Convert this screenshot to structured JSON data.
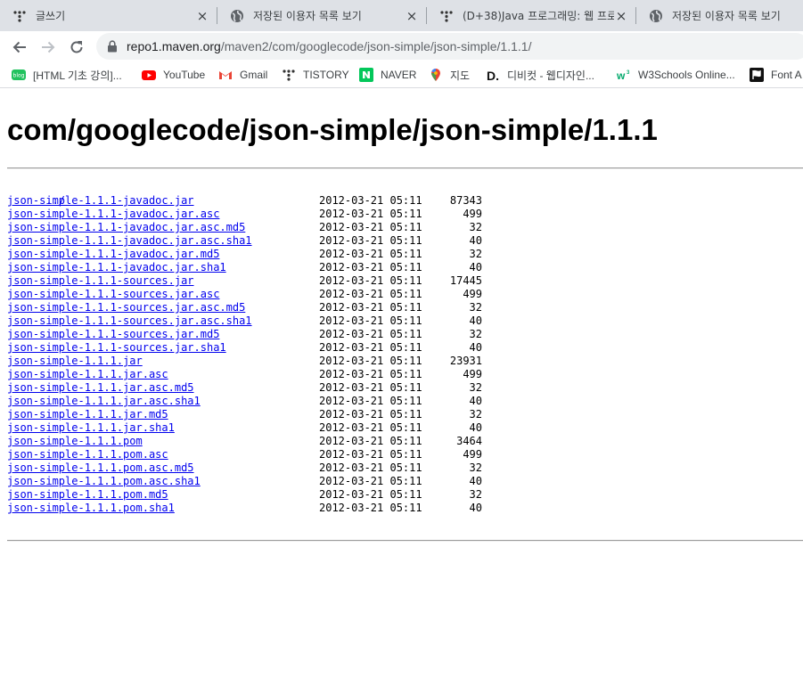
{
  "tabs": [
    {
      "title": "글쓰기",
      "icon": "tistory-icon",
      "close": "×"
    },
    {
      "title": "저장된 이용자 목록 보기",
      "icon": "globe-icon",
      "close": "×"
    },
    {
      "title": "(D+38)Java 프로그래밍: 웹 프로",
      "icon": "tistory-icon",
      "close": "×"
    },
    {
      "title": "저장된 이용자 목록 보기",
      "icon": "globe-icon",
      "close": ""
    }
  ],
  "address": {
    "host": "repo1.maven.org",
    "path": "/maven2/com/googlecode/json-simple/json-simple/1.1.1/"
  },
  "bookmarks": [
    {
      "label": "[HTML 기초 강의]...",
      "icon": "naver-blog-icon"
    },
    {
      "label": "YouTube",
      "icon": "youtube-icon"
    },
    {
      "label": "Gmail",
      "icon": "gmail-icon"
    },
    {
      "label": "TISTORY",
      "icon": "tistory-icon"
    },
    {
      "label": "NAVER",
      "icon": "naver-icon"
    },
    {
      "label": "지도",
      "icon": "google-maps-icon"
    },
    {
      "label": "디비컷 - 웹디자인...",
      "icon": "dbcut-icon"
    },
    {
      "label": "W3Schools Online...",
      "icon": "w3schools-icon"
    },
    {
      "label": "Font A",
      "icon": "font-awesome-icon"
    }
  ],
  "page": {
    "heading": "com/googlecode/json-simple/json-simple/1.1.1",
    "parent_link": "../",
    "files": [
      {
        "name": "json-simple-1.1.1-javadoc.jar",
        "date": "2012-03-21 05:11",
        "size": "87343"
      },
      {
        "name": "json-simple-1.1.1-javadoc.jar.asc",
        "date": "2012-03-21 05:11",
        "size": "499"
      },
      {
        "name": "json-simple-1.1.1-javadoc.jar.asc.md5",
        "date": "2012-03-21 05:11",
        "size": "32"
      },
      {
        "name": "json-simple-1.1.1-javadoc.jar.asc.sha1",
        "date": "2012-03-21 05:11",
        "size": "40"
      },
      {
        "name": "json-simple-1.1.1-javadoc.jar.md5",
        "date": "2012-03-21 05:11",
        "size": "32"
      },
      {
        "name": "json-simple-1.1.1-javadoc.jar.sha1",
        "date": "2012-03-21 05:11",
        "size": "40"
      },
      {
        "name": "json-simple-1.1.1-sources.jar",
        "date": "2012-03-21 05:11",
        "size": "17445"
      },
      {
        "name": "json-simple-1.1.1-sources.jar.asc",
        "date": "2012-03-21 05:11",
        "size": "499"
      },
      {
        "name": "json-simple-1.1.1-sources.jar.asc.md5",
        "date": "2012-03-21 05:11",
        "size": "32"
      },
      {
        "name": "json-simple-1.1.1-sources.jar.asc.sha1",
        "date": "2012-03-21 05:11",
        "size": "40"
      },
      {
        "name": "json-simple-1.1.1-sources.jar.md5",
        "date": "2012-03-21 05:11",
        "size": "32"
      },
      {
        "name": "json-simple-1.1.1-sources.jar.sha1",
        "date": "2012-03-21 05:11",
        "size": "40"
      },
      {
        "name": "json-simple-1.1.1.jar",
        "date": "2012-03-21 05:11",
        "size": "23931"
      },
      {
        "name": "json-simple-1.1.1.jar.asc",
        "date": "2012-03-21 05:11",
        "size": "499"
      },
      {
        "name": "json-simple-1.1.1.jar.asc.md5",
        "date": "2012-03-21 05:11",
        "size": "32"
      },
      {
        "name": "json-simple-1.1.1.jar.asc.sha1",
        "date": "2012-03-21 05:11",
        "size": "40"
      },
      {
        "name": "json-simple-1.1.1.jar.md5",
        "date": "2012-03-21 05:11",
        "size": "32"
      },
      {
        "name": "json-simple-1.1.1.jar.sha1",
        "date": "2012-03-21 05:11",
        "size": "40"
      },
      {
        "name": "json-simple-1.1.1.pom",
        "date": "2012-03-21 05:11",
        "size": "3464"
      },
      {
        "name": "json-simple-1.1.1.pom.asc",
        "date": "2012-03-21 05:11",
        "size": "499"
      },
      {
        "name": "json-simple-1.1.1.pom.asc.md5",
        "date": "2012-03-21 05:11",
        "size": "32"
      },
      {
        "name": "json-simple-1.1.1.pom.asc.sha1",
        "date": "2012-03-21 05:11",
        "size": "40"
      },
      {
        "name": "json-simple-1.1.1.pom.md5",
        "date": "2012-03-21 05:11",
        "size": "32"
      },
      {
        "name": "json-simple-1.1.1.pom.sha1",
        "date": "2012-03-21 05:11",
        "size": "40"
      }
    ]
  },
  "colors": {
    "tabstrip_bg": "#dee1e6",
    "link": "#0000ee",
    "omnibox_bg": "#f1f3f4"
  }
}
